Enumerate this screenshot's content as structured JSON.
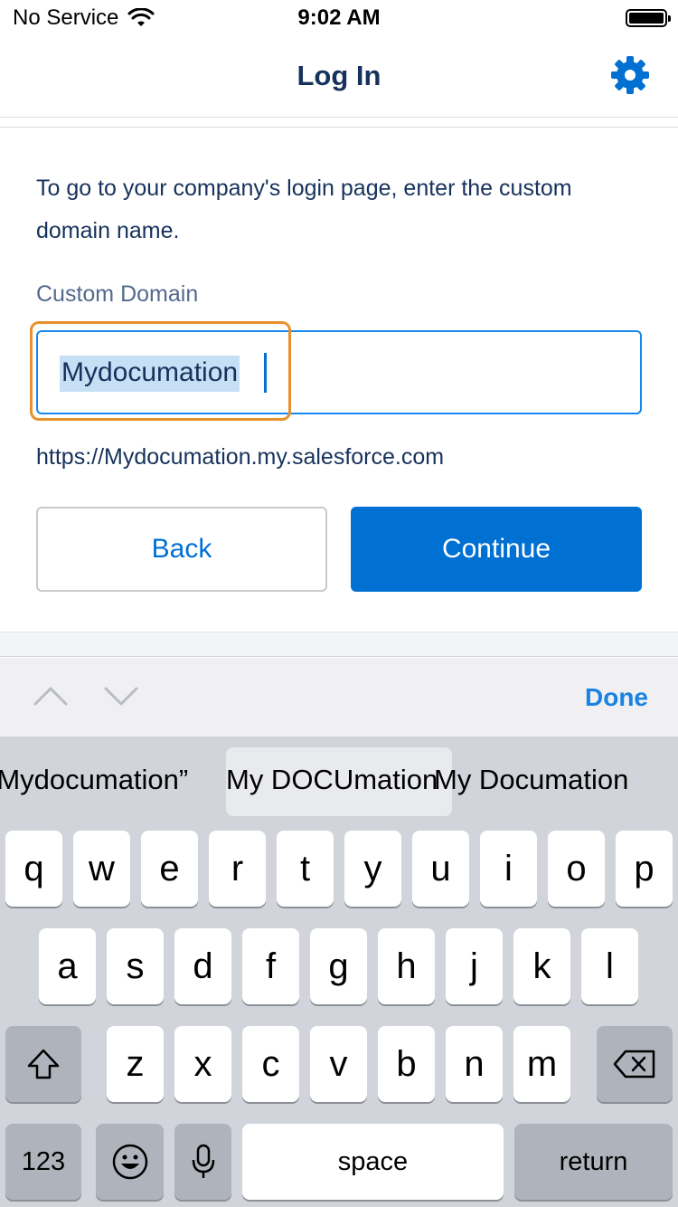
{
  "status_bar": {
    "carrier": "No Service",
    "time": "9:02 AM"
  },
  "nav": {
    "title": "Log In"
  },
  "content": {
    "instructions": "To go to your company's login page, enter the custom domain name.",
    "field_label": "Custom Domain",
    "domain_value": "Mydocumation",
    "domain_url": "https://Mydocumation.my.salesforce.com",
    "back_label": "Back",
    "continue_label": "Continue"
  },
  "accessory": {
    "done_label": "Done"
  },
  "keyboard": {
    "suggestions": [
      "“Mydocumation”",
      "My DOCUmation",
      "My Documation"
    ],
    "row1": [
      "q",
      "w",
      "e",
      "r",
      "t",
      "y",
      "u",
      "i",
      "o",
      "p"
    ],
    "row2": [
      "a",
      "s",
      "d",
      "f",
      "g",
      "h",
      "j",
      "k",
      "l"
    ],
    "row3": [
      "z",
      "x",
      "c",
      "v",
      "b",
      "n",
      "m"
    ],
    "numbers_label": "123",
    "space_label": "space",
    "return_label": "return"
  },
  "colors": {
    "accent": "#0070d2",
    "title": "#16325c",
    "highlight_outline": "#e8902d"
  }
}
